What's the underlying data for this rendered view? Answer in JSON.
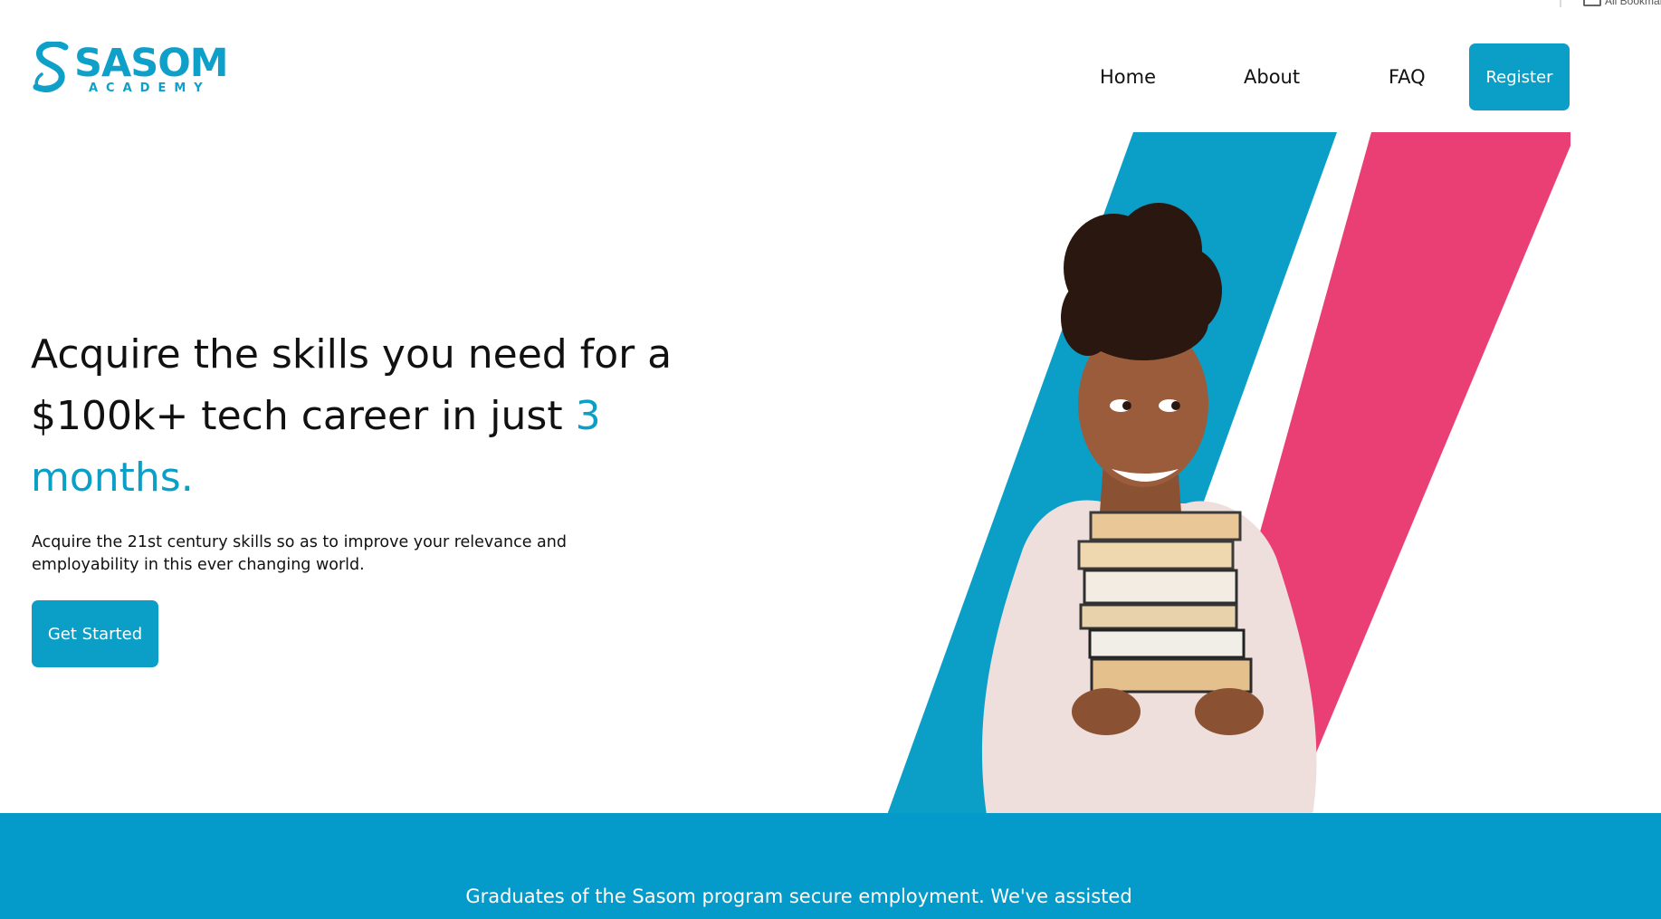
{
  "browser": {
    "bookmarks_label": "All Bookmarks"
  },
  "brand": {
    "name": "SASOM",
    "tagline": "ACADEMY",
    "color": "#0fa0c9"
  },
  "nav": {
    "home": "Home",
    "about": "About",
    "faq": "FAQ",
    "register": "Register"
  },
  "hero": {
    "title_main": "Acquire the skills you need for a $100k+ tech career in just ",
    "title_accent": "3 months.",
    "description": "Acquire the 21st century skills so as to improve your relevance and employability in this ever changing world.",
    "cta": "Get Started"
  },
  "band": {
    "text": "Graduates of the Sasom program secure employment. We've assisted"
  },
  "colors": {
    "primary": "#0b9fc8",
    "accent_pink": "#ea3f74",
    "band": "#049ac9"
  },
  "icons": {
    "logo": "sasom-s-logo",
    "bookmarks": "folder-icon"
  }
}
